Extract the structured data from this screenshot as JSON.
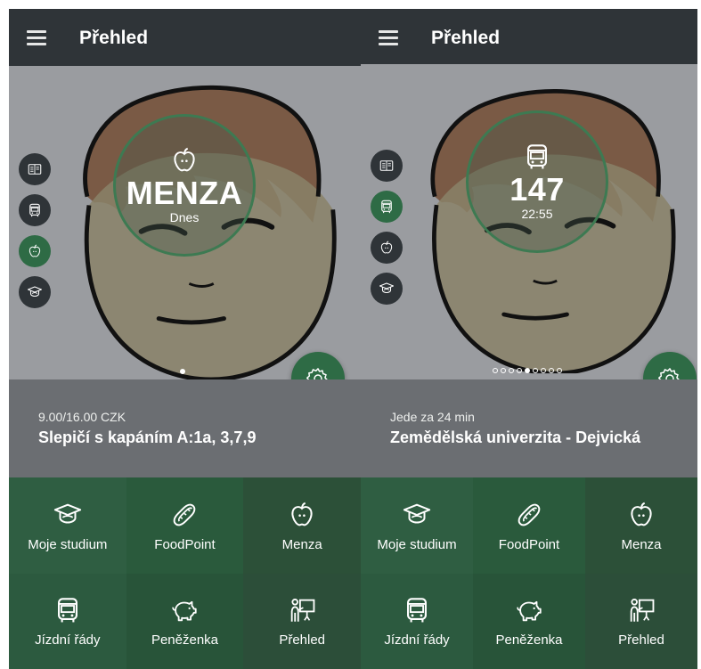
{
  "screens": [
    {
      "header": {
        "title": "Přehled",
        "menu_icon": "hamburger-icon"
      },
      "side_nav": [
        {
          "icon": "timetable-icon",
          "active": false
        },
        {
          "icon": "bus-icon",
          "active": false
        },
        {
          "icon": "apple-icon",
          "active": true
        },
        {
          "icon": "graduation-cap-icon",
          "active": false
        }
      ],
      "widget": {
        "icon": "apple-icon",
        "big": "MENZA",
        "small": "Dnes"
      },
      "pager": {
        "count": 1,
        "active": 0
      },
      "info": {
        "sub": "9.00/16.00 CZK",
        "main": "Slepičí  s kapáním  A:1a, 3,7,9"
      },
      "tiles": [
        {
          "label": "Moje studium",
          "icon": "graduation-cap-icon"
        },
        {
          "label": "FoodPoint",
          "icon": "hotdog-icon"
        },
        {
          "label": "Menza",
          "icon": "apple-icon"
        },
        {
          "label": "Jízdní řády",
          "icon": "bus-icon"
        },
        {
          "label": "Peněženka",
          "icon": "piggy-bank-icon"
        },
        {
          "label": "Přehled",
          "icon": "presentation-icon"
        }
      ]
    },
    {
      "header": {
        "title": "Přehled",
        "menu_icon": "hamburger-icon"
      },
      "side_nav": [
        {
          "icon": "timetable-icon",
          "active": false
        },
        {
          "icon": "bus-icon",
          "active": true
        },
        {
          "icon": "apple-icon",
          "active": false
        },
        {
          "icon": "graduation-cap-icon",
          "active": false
        }
      ],
      "widget": {
        "icon": "bus-icon",
        "big": "147",
        "small": "22:55"
      },
      "pager": {
        "count": 9,
        "active": 4
      },
      "info": {
        "sub": "Jede za 24 min",
        "main": "Zemědělská univerzita - Dejvická"
      },
      "tiles": [
        {
          "label": "Moje studium",
          "icon": "graduation-cap-icon"
        },
        {
          "label": "FoodPoint",
          "icon": "hotdog-icon"
        },
        {
          "label": "Menza",
          "icon": "apple-icon"
        },
        {
          "label": "Jízdní řády",
          "icon": "bus-icon"
        },
        {
          "label": "Peněženka",
          "icon": "piggy-bank-icon"
        },
        {
          "label": "Přehled",
          "icon": "presentation-icon"
        }
      ]
    }
  ],
  "colors": {
    "header": "#2f3438",
    "accent_green": "#2e6b45",
    "tile_green": "#2c5a3f",
    "info_gray": "#6b6e72"
  }
}
